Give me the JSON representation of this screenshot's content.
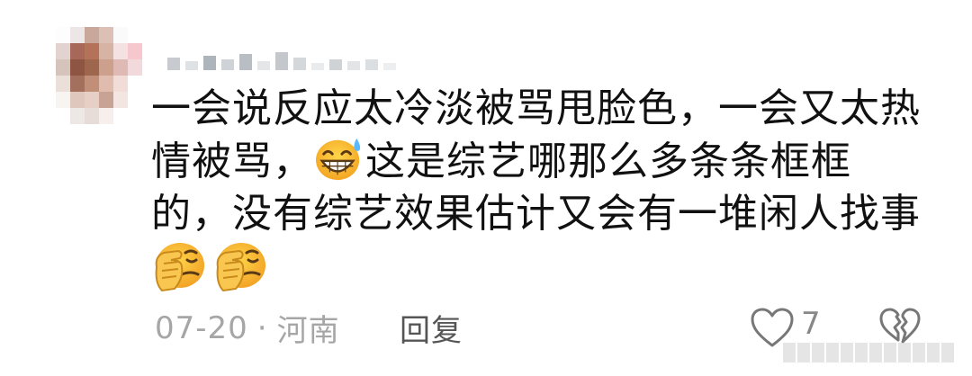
{
  "comment": {
    "avatar_icon": "pixelated-avatar-icon",
    "username_icon": "pixelated-username",
    "text_lines": [
      "一会说反应太冷淡被骂甩脸色，一会又太热",
      "情被骂，",
      "这是综艺哪那么多条条框框",
      "的，没有综艺效果估计又会有一堆闲人找事"
    ],
    "emoji_inline": "grinning-sweat-emoji",
    "emoji_end": [
      "facepalm-emoji",
      "facepalm-emoji"
    ],
    "date": "07-20",
    "separator": "·",
    "location": "河南",
    "reply_label": "回复",
    "like_count": "7",
    "like_icon": "heart-outline-icon",
    "dislike_icon": "broken-heart-outline-icon"
  },
  "colors": {
    "text": "#111111",
    "meta": "#a6a6a6",
    "reply": "#555555",
    "emoji_yellow": "#f7c236",
    "emoji_orange": "#f1a22a"
  }
}
